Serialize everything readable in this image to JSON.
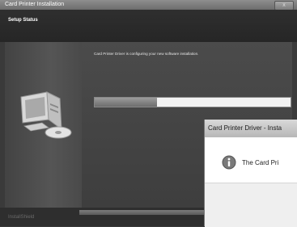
{
  "window": {
    "title": "Card Printer Installation",
    "close_label": "x"
  },
  "header": {
    "title": "Setup Status"
  },
  "main": {
    "status_message": "Card Printer Driver is configuring your new software installation.",
    "progress_fraction": 0.32
  },
  "footer": {
    "brand": "InstallShield"
  },
  "dialog": {
    "title": "Card Printer Driver - Insta",
    "message": "The Card Pri"
  },
  "icons": [
    "computer-icon",
    "info-icon"
  ]
}
